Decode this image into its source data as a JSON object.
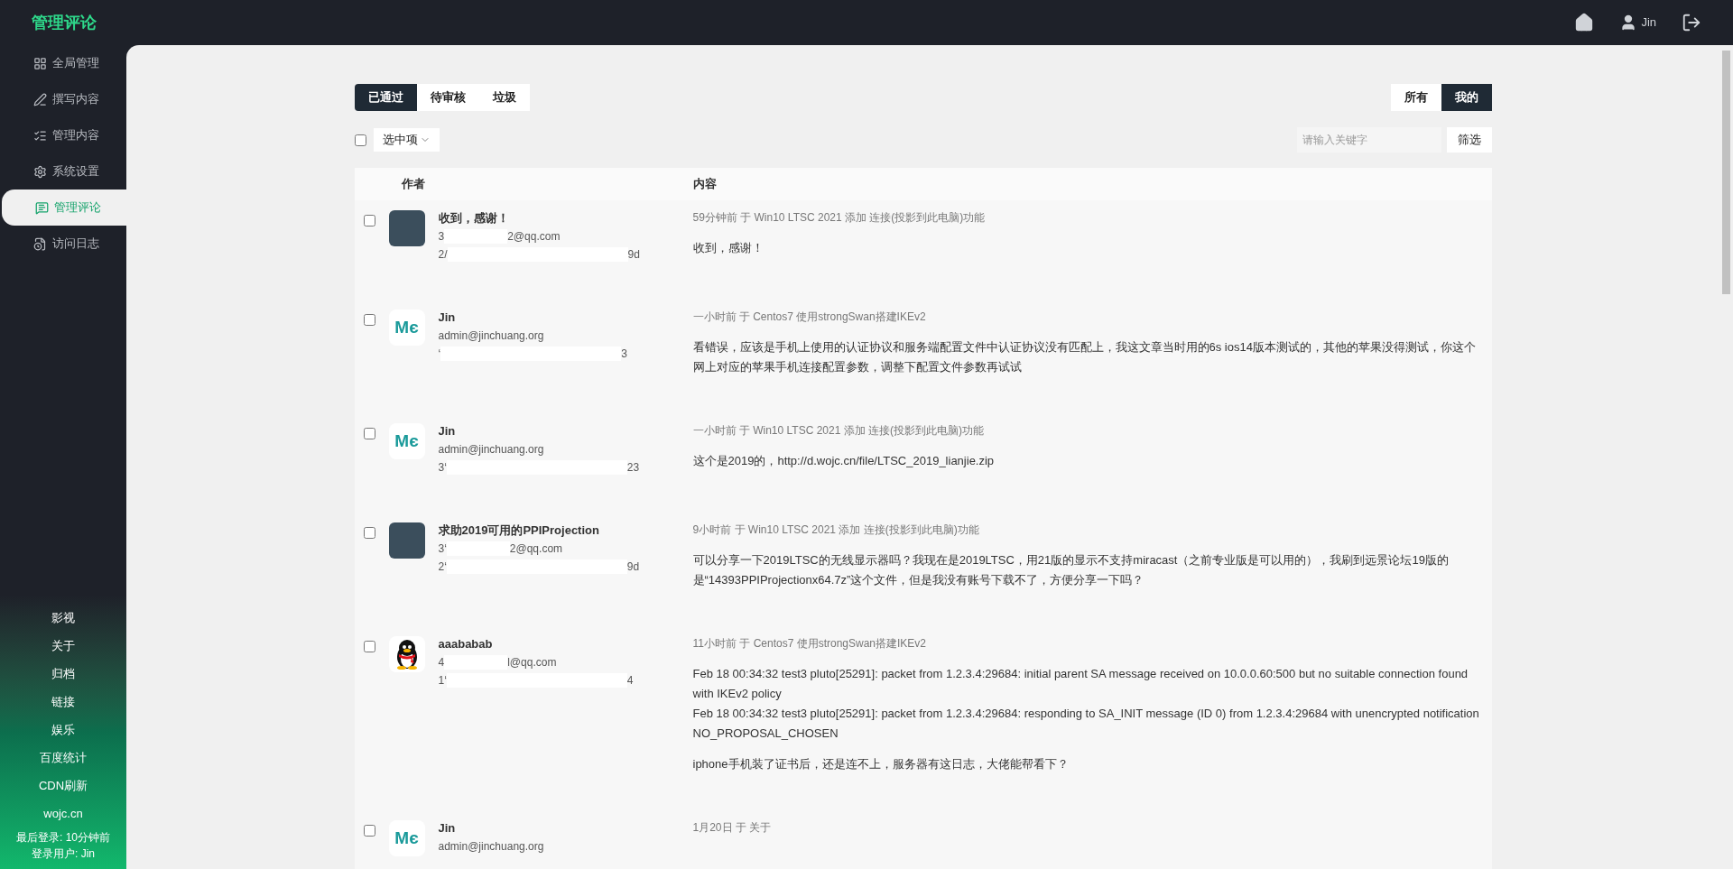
{
  "header": {
    "title": "管理评论",
    "user": "Jin"
  },
  "sidebar": {
    "items": [
      {
        "label": "全局管理",
        "kind": "grid",
        "selected": false
      },
      {
        "label": "撰写内容",
        "kind": "pen",
        "selected": false
      },
      {
        "label": "管理内容",
        "kind": "list",
        "selected": false
      },
      {
        "label": "系统设置",
        "kind": "gear",
        "selected": false
      },
      {
        "label": "管理评论",
        "kind": "comment",
        "selected": true
      },
      {
        "label": "访问日志",
        "kind": "log",
        "selected": false
      }
    ],
    "links": [
      "影视",
      "关于",
      "归档",
      "链接",
      "娱乐",
      "百度统计",
      "CDN刷新",
      "wojc.cn"
    ],
    "last_login": "最后登录: 10分钟前",
    "login_user": "登录用户: Jin"
  },
  "status_tabs": [
    {
      "label": "已通过",
      "selected": true
    },
    {
      "label": "待审核",
      "selected": false
    },
    {
      "label": "垃圾",
      "selected": false
    }
  ],
  "scope_tabs": [
    {
      "label": "所有",
      "selected": false
    },
    {
      "label": "我的",
      "selected": true
    }
  ],
  "select_all": {
    "checked": false
  },
  "bulk_dropdown": {
    "label": "选中项"
  },
  "search": {
    "placeholder": "请输入关键字"
  },
  "filter_button": "筛选",
  "table": {
    "columns": [
      "作者",
      "内容"
    ],
    "rows": [
      {
        "checked": false,
        "avatar": {
          "kind": "photo"
        },
        "author": "收到，感谢！",
        "email": [
          "3",
          "2@qq.com"
        ],
        "ip": [
          "2/",
          "9d"
        ],
        "meta": "59分钟前 于 Win10 LTSC 2021 添加 连接(投影到此电脑)功能",
        "body": [
          "收到，感谢！"
        ]
      },
      {
        "checked": false,
        "avatar": {
          "kind": "logo",
          "text": "Mє"
        },
        "author": "Jin",
        "email": [
          "admin@jinchuang.org"
        ],
        "ip": [
          "‘",
          "3"
        ],
        "meta": "一小时前 于 Centos7 使用strongSwan搭建IKEv2",
        "body": [
          "看错误，应该是手机上使用的认证协议和服务端配置文件中认证协议没有匹配上，我这文章当时用的6s ios14版本测试的，其他的苹果没得测试，你这个网上对应的苹果手机连接配置参数，调整下配置文件参数再试试"
        ]
      },
      {
        "checked": false,
        "avatar": {
          "kind": "logo",
          "text": "Mє"
        },
        "author": "Jin",
        "email": [
          "admin@jinchuang.org"
        ],
        "ip": [
          "3‘",
          "23"
        ],
        "meta": "一小时前 于 Win10 LTSC 2021 添加 连接(投影到此电脑)功能",
        "body": [
          "这个是2019的，http://d.wojc.cn/file/LTSC_2019_lianjie.zip"
        ]
      },
      {
        "checked": false,
        "avatar": {
          "kind": "photo"
        },
        "author": "求助2019可用的PPIProjection",
        "email": [
          "3‘",
          "2@qq.com"
        ],
        "ip": [
          "2‘",
          "9d"
        ],
        "meta": "9小时前 于 Win10 LTSC 2021 添加 连接(投影到此电脑)功能",
        "body": [
          "可以分享一下2019LTSC的无线显示器吗？我现在是2019LTSC，用21版的显示不支持miracast（之前专业版是可以用的），我刷到远景论坛19版的是“14393PPIProjectionx64.7z”这个文件，但是我没有账号下载不了，方便分享一下吗？"
        ]
      },
      {
        "checked": false,
        "avatar": {
          "kind": "penguin"
        },
        "author": "aaababab",
        "email": [
          "4",
          "l@qq.com"
        ],
        "ip": [
          "1‘",
          "4"
        ],
        "meta": "11小时前 于 Centos7 使用strongSwan搭建IKEv2",
        "body": [
          "Feb 18 00:34:32 test3 pluto[25291]: packet from 1.2.3.4:29684: initial parent SA message received on 10.0.0.60:500 but no suitable connection found with IKEv2 policy\nFeb 18 00:34:32 test3 pluto[25291]: packet from 1.2.3.4:29684: responding to SA_INIT message (ID 0) from 1.2.3.4:29684 with unencrypted notification NO_PROPOSAL_CHOSEN",
          "iphone手机装了证书后，还是连不上，服务器有这日志，大佬能帮看下？"
        ]
      },
      {
        "checked": false,
        "avatar": {
          "kind": "logo",
          "text": "Mє"
        },
        "author": "Jin",
        "email": [
          "admin@jinchuang.org"
        ],
        "ip": [],
        "meta": "1月20日 于 关于",
        "body": []
      }
    ]
  }
}
